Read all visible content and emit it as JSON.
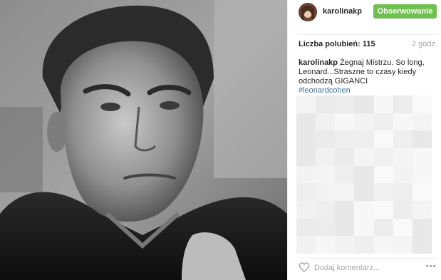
{
  "photo": {
    "description_icon": "photo-image"
  },
  "header": {
    "username": "karolinakp",
    "follow_label": "Obserwowanie",
    "follow_color": "#70c050"
  },
  "stats": {
    "likes": "Liczba polubień: 115",
    "time": "2 godz."
  },
  "caption": {
    "user": "karolinakp",
    "text": " Żegnaj Mistrzu. So long, Leonard...Straszne to czasy kiedy odchodzą GIGANCI",
    "hashtag": "#leonardcohen",
    "hashtag_color": "#3f729b"
  },
  "comment": {
    "placeholder": "Dodaj komentarz...",
    "like_icon": "heart-icon",
    "more_icon": "more-options-icon"
  }
}
